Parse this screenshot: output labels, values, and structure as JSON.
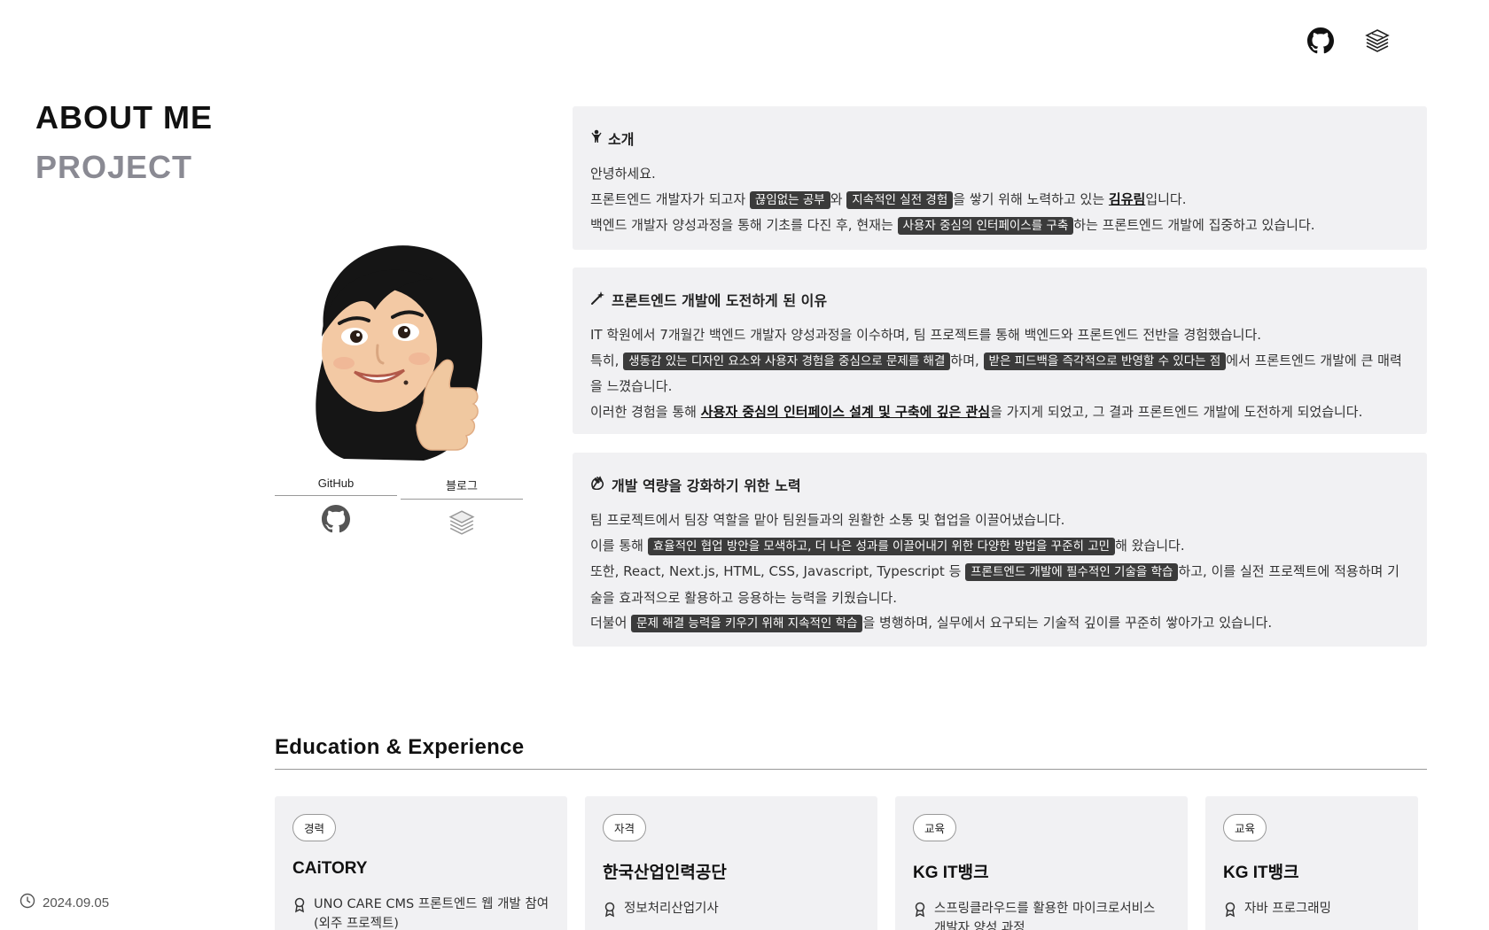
{
  "header": {
    "github_icon": "github-icon",
    "blog_icon": "stack-blog-icon"
  },
  "nav": {
    "about": "ABOUT ME",
    "project": "PROJECT"
  },
  "footer": {
    "date": "2024.09.05",
    "icon": "clock-icon"
  },
  "profile": {
    "avatar": "memoji-avatar",
    "github_label": "GitHub",
    "blog_label": "블로그"
  },
  "intro": {
    "title": "소개",
    "icon": "person-icon",
    "line1": "안녕하세요.",
    "line2_a": "프론트엔드 개발자가 되고자 ",
    "line2_h1": "끊임없는 공부",
    "line2_b": "와 ",
    "line2_h2": "지속적인 실전 경험",
    "line2_c": "을 쌓기 위해 노력하고 있는 ",
    "line2_name": "김유림",
    "line2_d": "입니다.",
    "line3_a": "백엔드 개발자 양성과정을 통해 기초를 다진 후, 현재는 ",
    "line3_h": "사용자 중심의 인터페이스를 구축",
    "line3_b": "하는 프론트엔드 개발에 집중하고 있습니다."
  },
  "reason": {
    "title": "프론트엔드 개발에 도전하게 된 이유",
    "icon": "magic-wand-icon",
    "line1": "IT 학원에서 7개월간 백엔드 개발자 양성과정을 이수하며, 팀 프로젝트를 통해 백엔드와 프론트엔드 전반을 경험했습니다.",
    "line2_a": "특히, ",
    "line2_h1": "생동감 있는 디자인 요소와 사용자 경험을 중심으로 문제를 해결",
    "line2_b": "하며, ",
    "line2_h2": "받은 피드백을 즉각적으로 반영할 수 있다는 점",
    "line2_c": "에서 프론트엔드 개발에 큰 매력을 느꼈습니다.",
    "line3_a": "이러한 경험을 통해 ",
    "line3_u": "사용자 중심의 인터페이스 설계 및 구축에 깊은 관심",
    "line3_b": "을 가지게 되었고, 그 결과 프론트엔드 개발에 도전하게 되었습니다."
  },
  "effort": {
    "title": "개발 역량을 강화하기 위한 노력",
    "icon": "clapping-hands-icon",
    "line1": "팀 프로젝트에서 팀장 역할을 맡아 팀원들과의 원활한 소통 및 협업을 이끌어냈습니다.",
    "line2_a": "이를 통해 ",
    "line2_h": "효율적인 협업 방안을 모색하고, 더 나은 성과를 이끌어내기 위한 다양한 방법을 꾸준히 고민",
    "line2_b": "해 왔습니다.",
    "line3_a": "또한, React, Next.js, HTML, CSS, Javascript, Typescript 등 ",
    "line3_h": "프론트엔드 개발에 필수적인 기술을 학습",
    "line3_b": "하고, 이를 실전 프로젝트에 적용하며 기술을 효과적으로 활용하고 응용하는 능력을 키웠습니다.",
    "line4_a": "더불어 ",
    "line4_h": "문제 해결 능력을 키우기 위해 지속적인 학습",
    "line4_b": "을 병행하며, 실무에서 요구되는 기술적 깊이를 꾸준히 쌓아가고 있습니다."
  },
  "education": {
    "title": "Education & Experience",
    "cards": [
      {
        "badge": "경력",
        "org": "CAiTORY",
        "item": "UNO CARE CMS 프론트엔드 웹 개발 참여(외주 프로젝트)"
      },
      {
        "badge": "자격",
        "org": "한국산업인력공단",
        "item": "정보처리산업기사"
      },
      {
        "badge": "교육",
        "org": "KG IT뱅크",
        "item": "스프링클라우드를 활용한 마이크로서비스 개발자 양성 과정"
      },
      {
        "badge": "교육",
        "org": "KG IT뱅크",
        "item": "자바 프로그래밍"
      }
    ]
  }
}
